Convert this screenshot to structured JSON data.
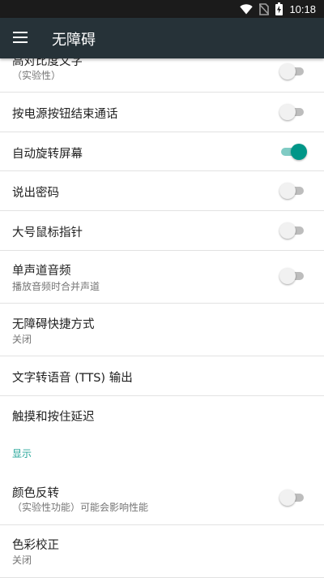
{
  "status_bar": {
    "time": "10:18",
    "icons": [
      "wifi-icon",
      "no-sim-icon",
      "battery-charging-icon"
    ]
  },
  "app_bar": {
    "title": "无障碍",
    "menu_icon": "hamburger-menu-icon"
  },
  "colors": {
    "app_bar": "#263238",
    "status_bar": "#1b1b1b",
    "accent": "#009688",
    "section_header": "#26a69a"
  },
  "settings": {
    "high_contrast": {
      "title": "高对比度文字",
      "subtitle": "（实验性）",
      "enabled": false
    },
    "power_button_end_call": {
      "title": "按电源按钮结束通话",
      "enabled": false
    },
    "auto_rotate": {
      "title": "自动旋转屏幕",
      "enabled": true
    },
    "speak_passwords": {
      "title": "说出密码",
      "enabled": false
    },
    "large_pointer": {
      "title": "大号鼠标指针",
      "enabled": false
    },
    "mono_audio": {
      "title": "单声道音频",
      "subtitle": "播放音频时合并声道",
      "enabled": false
    },
    "shortcut": {
      "title": "无障碍快捷方式",
      "subtitle": "关闭"
    },
    "tts": {
      "title": "文字转语音 (TTS) 输出"
    },
    "touch_hold_delay": {
      "title": "触摸和按住延迟"
    },
    "display_section": {
      "title": "显示"
    },
    "color_inversion": {
      "title": "颜色反转",
      "subtitle": "（实验性功能）可能会影响性能",
      "enabled": false
    },
    "color_correction": {
      "title": "色彩校正",
      "subtitle": "关闭"
    }
  }
}
